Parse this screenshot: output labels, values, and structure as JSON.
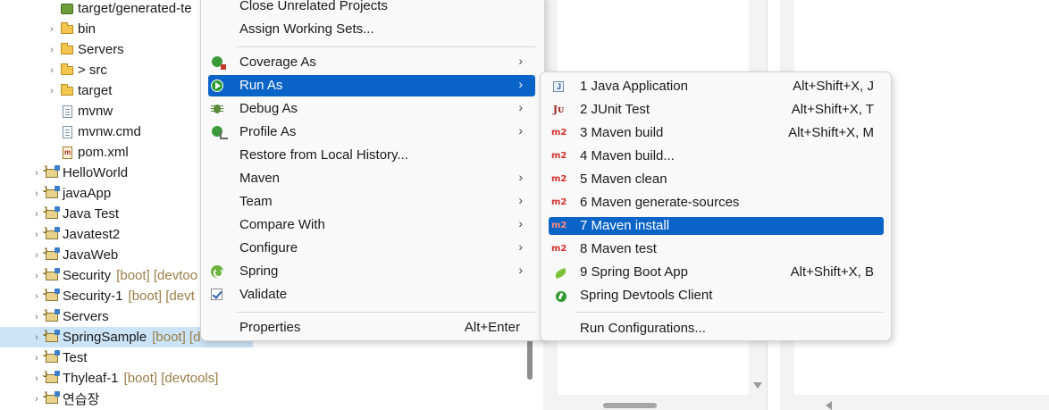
{
  "tree": {
    "items": [
      {
        "label": "target/generated-te",
        "deco": "",
        "depth": 2,
        "twisty": false,
        "icon": "generated-folder-icon"
      },
      {
        "label": "bin",
        "deco": "",
        "depth": 2,
        "twisty": true,
        "icon": "folder-icon"
      },
      {
        "label": "Servers",
        "deco": "",
        "depth": 2,
        "twisty": true,
        "icon": "folder-icon"
      },
      {
        "label": "> src",
        "deco": "",
        "depth": 2,
        "twisty": true,
        "icon": "folder-icon"
      },
      {
        "label": "target",
        "deco": "",
        "depth": 2,
        "twisty": true,
        "icon": "folder-icon"
      },
      {
        "label": "mvnw",
        "deco": "",
        "depth": 2,
        "twisty": false,
        "icon": "file-icon"
      },
      {
        "label": "mvnw.cmd",
        "deco": "",
        "depth": 2,
        "twisty": false,
        "icon": "file-icon"
      },
      {
        "label": "pom.xml",
        "deco": "",
        "depth": 2,
        "twisty": false,
        "icon": "xml-file-icon"
      },
      {
        "label": "HelloWorld",
        "deco": "",
        "depth": 1,
        "twisty": true,
        "icon": "project-icon"
      },
      {
        "label": "javaApp",
        "deco": "",
        "depth": 1,
        "twisty": true,
        "icon": "project-icon"
      },
      {
        "label": "Java Test",
        "deco": "",
        "depth": 1,
        "twisty": true,
        "icon": "project-icon"
      },
      {
        "label": "Javatest2",
        "deco": "",
        "depth": 1,
        "twisty": true,
        "icon": "project-icon"
      },
      {
        "label": "JavaWeb",
        "deco": "",
        "depth": 1,
        "twisty": true,
        "icon": "project-icon"
      },
      {
        "label": "Security",
        "deco": "[boot] [devtoo",
        "depth": 1,
        "twisty": true,
        "icon": "project-icon"
      },
      {
        "label": "Security-1",
        "deco": "[boot] [devt",
        "depth": 1,
        "twisty": true,
        "icon": "project-icon"
      },
      {
        "label": "Servers",
        "deco": "",
        "depth": 1,
        "twisty": true,
        "icon": "project-icon"
      },
      {
        "label": "SpringSample",
        "deco": "[boot] [d",
        "depth": 1,
        "twisty": true,
        "icon": "project-icon",
        "selected": true
      },
      {
        "label": "Test",
        "deco": "",
        "depth": 1,
        "twisty": true,
        "icon": "project-icon"
      },
      {
        "label": "Thyleaf-1",
        "deco": "[boot] [devtools]",
        "depth": 1,
        "twisty": true,
        "icon": "project-icon"
      },
      {
        "label": "연습장",
        "deco": "",
        "depth": 1,
        "twisty": true,
        "icon": "project-icon"
      }
    ]
  },
  "context_menu": {
    "items": [
      {
        "label": "Close Unrelated Projects",
        "accel": "",
        "submenu": false,
        "icon": ""
      },
      {
        "label": "Assign Working Sets...",
        "accel": "",
        "submenu": false,
        "icon": ""
      },
      {
        "label": "Coverage As",
        "accel": "",
        "submenu": true,
        "icon": "coverage-icon"
      },
      {
        "label": "Run As",
        "accel": "",
        "submenu": true,
        "icon": "run-icon",
        "highlighted": true
      },
      {
        "label": "Debug As",
        "accel": "",
        "submenu": true,
        "icon": "debug-icon"
      },
      {
        "label": "Profile As",
        "accel": "",
        "submenu": true,
        "icon": "profile-icon"
      },
      {
        "label": "Restore from Local History...",
        "accel": "",
        "submenu": false,
        "icon": ""
      },
      {
        "label": "Maven",
        "accel": "",
        "submenu": true,
        "icon": ""
      },
      {
        "label": "Team",
        "accel": "",
        "submenu": true,
        "icon": ""
      },
      {
        "label": "Compare With",
        "accel": "",
        "submenu": true,
        "icon": ""
      },
      {
        "label": "Configure",
        "accel": "",
        "submenu": true,
        "icon": ""
      },
      {
        "label": "Spring",
        "accel": "",
        "submenu": true,
        "icon": "spring-icon"
      },
      {
        "label": "Validate",
        "accel": "",
        "submenu": false,
        "icon": "validate-check-icon"
      },
      {
        "label": "Properties",
        "accel": "Alt+Enter",
        "submenu": false,
        "icon": ""
      }
    ],
    "submenu_arrow": "›"
  },
  "run_as_menu": {
    "items": [
      {
        "label": "1 Java Application",
        "accel": "Alt+Shift+X, J",
        "icon": "java-application-icon",
        "glyph": ""
      },
      {
        "label": "2 JUnit Test",
        "accel": "Alt+Shift+X, T",
        "icon": "junit-icon",
        "glyph": "Jᴜ"
      },
      {
        "label": "3 Maven build",
        "accel": "Alt+Shift+X, M",
        "icon": "maven-icon",
        "glyph": "m2"
      },
      {
        "label": "4 Maven build...",
        "accel": "",
        "icon": "maven-icon",
        "glyph": "m2"
      },
      {
        "label": "5 Maven clean",
        "accel": "",
        "icon": "maven-icon",
        "glyph": "m2"
      },
      {
        "label": "6 Maven generate-sources",
        "accel": "",
        "icon": "maven-icon",
        "glyph": "m2"
      },
      {
        "label": "7 Maven install",
        "accel": "",
        "icon": "maven-icon",
        "glyph": "m2",
        "highlighted": true
      },
      {
        "label": "8 Maven test",
        "accel": "",
        "icon": "maven-icon",
        "glyph": "m2"
      },
      {
        "label": "9 Spring Boot App",
        "accel": "Alt+Shift+X, B",
        "icon": "spring-boot-icon",
        "glyph": ""
      },
      {
        "label": "Spring Devtools Client",
        "accel": "",
        "icon": "spring-devtools-icon",
        "glyph": ""
      },
      {
        "label": "Run Configurations...",
        "accel": "",
        "icon": "",
        "glyph": ""
      }
    ]
  }
}
